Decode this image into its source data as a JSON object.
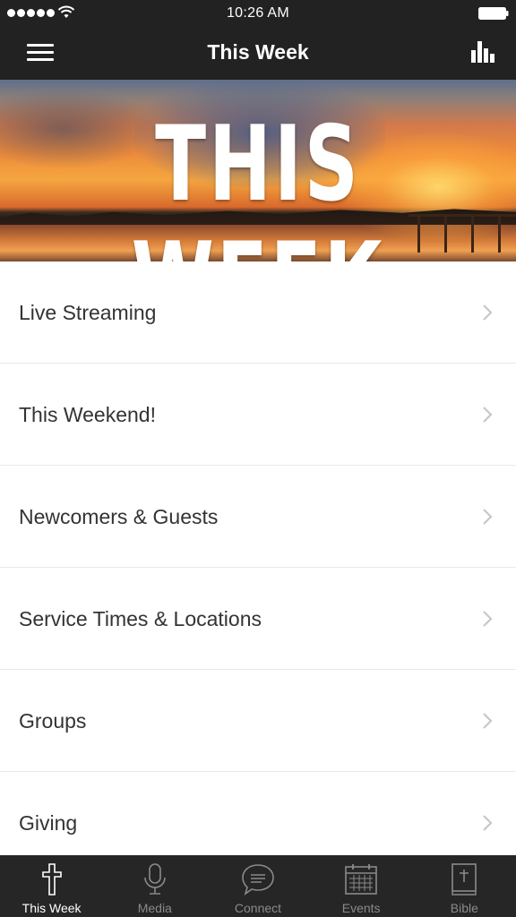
{
  "status_bar": {
    "time": "10:26 AM",
    "signal_icon": "signal-dots-icon",
    "wifi_icon": "wifi-icon",
    "battery_icon": "battery-icon"
  },
  "nav": {
    "title": "This Week",
    "left_icon": "hamburger-menu-icon",
    "right_icon": "bar-chart-icon"
  },
  "hero": {
    "text": "THIS WEEK"
  },
  "menu": {
    "items": [
      {
        "label": "Live Streaming"
      },
      {
        "label": "This Weekend!"
      },
      {
        "label": "Newcomers & Guests"
      },
      {
        "label": "Service Times & Locations"
      },
      {
        "label": "Groups"
      },
      {
        "label": "Giving"
      }
    ]
  },
  "tab_bar": {
    "tabs": [
      {
        "label": "This Week",
        "icon": "cross-icon",
        "active": true
      },
      {
        "label": "Media",
        "icon": "microphone-icon",
        "active": false
      },
      {
        "label": "Connect",
        "icon": "chat-bubble-icon",
        "active": false
      },
      {
        "label": "Events",
        "icon": "calendar-icon",
        "active": false
      },
      {
        "label": "Bible",
        "icon": "bible-icon",
        "active": false
      }
    ]
  },
  "colors": {
    "bar_background": "#222222",
    "tab_active": "#ffffff",
    "tab_inactive": "#8a8a8a",
    "list_text": "#333333",
    "chevron": "#c7c7cc"
  }
}
